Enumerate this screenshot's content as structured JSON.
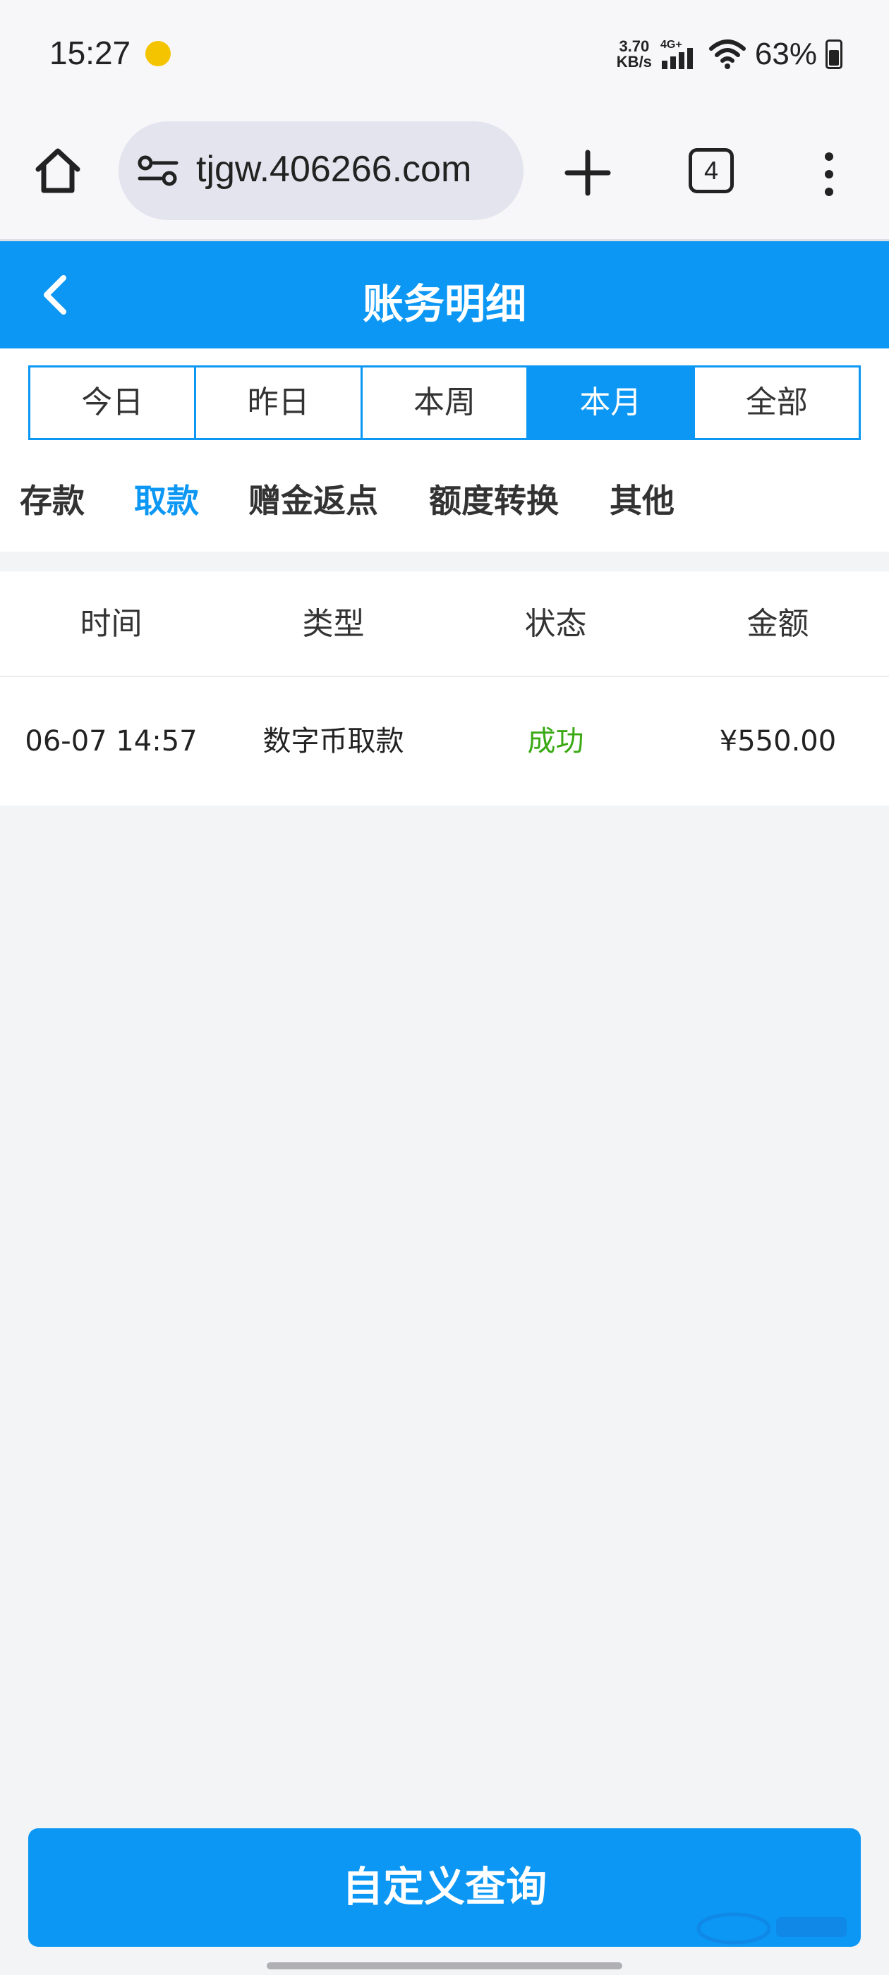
{
  "status_bar": {
    "time": "15:27",
    "net_speed_value": "3.70",
    "net_speed_unit": "KB/s",
    "network": "4G+",
    "battery": "63%"
  },
  "browser": {
    "url": "tjgw.406266.com",
    "tab_count": "4"
  },
  "header": {
    "title": "账务明细"
  },
  "period_tabs": [
    {
      "label": "今日",
      "active": false
    },
    {
      "label": "昨日",
      "active": false
    },
    {
      "label": "本周",
      "active": false
    },
    {
      "label": "本月",
      "active": true
    },
    {
      "label": "全部",
      "active": false
    }
  ],
  "category_tabs": [
    {
      "label": "存款",
      "active": false
    },
    {
      "label": "取款",
      "active": true
    },
    {
      "label": "赠金返点",
      "active": false
    },
    {
      "label": "额度转换",
      "active": false
    },
    {
      "label": "其他",
      "active": false
    }
  ],
  "table": {
    "columns": [
      "时间",
      "类型",
      "状态",
      "金额"
    ],
    "rows": [
      {
        "time": "06-07 14:57",
        "type": "数字币取款",
        "status": "成功",
        "amount": "¥550.00"
      }
    ]
  },
  "footer": {
    "custom_query_label": "自定义查询"
  },
  "colors": {
    "accent": "#0b97f3",
    "success": "#3aa913",
    "background": "#f3f4f6"
  }
}
